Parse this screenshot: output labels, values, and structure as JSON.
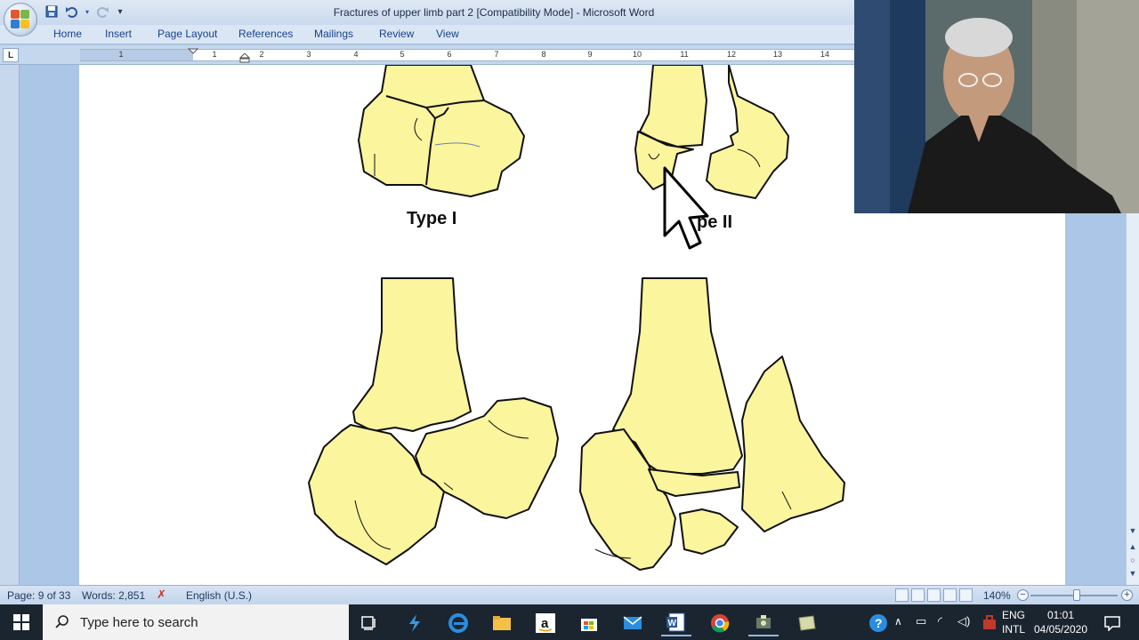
{
  "window": {
    "title": "Fractures of upper limb part 2 [Compatibility Mode] - Microsoft Word"
  },
  "ribbon": {
    "tabs": [
      "Home",
      "Insert",
      "Page Layout",
      "References",
      "Mailings",
      "Review",
      "View"
    ]
  },
  "ruler": {
    "numbers": [
      "1",
      "1",
      "2",
      "3",
      "4",
      "5",
      "6",
      "7",
      "8",
      "9",
      "10",
      "11",
      "12",
      "13",
      "14"
    ]
  },
  "document": {
    "figure_labels": {
      "type1": "Type I",
      "type2": "pe II"
    }
  },
  "statusbar": {
    "page": "Page: 9 of 33",
    "words": "Words: 2,851",
    "language": "English (U.S.)",
    "zoom": "140%",
    "zoom_level": 1.4
  },
  "taskbar": {
    "search_placeholder": "Type here to search",
    "lang_top": "ENG",
    "lang_bottom": "INTL",
    "time": "01:01",
    "date": "04/05/2020"
  },
  "colors": {
    "bone_fill": "#fbf59e",
    "ribbon_bg": "#dbe6f4",
    "workspace_bg": "#abc6e6",
    "taskbar_bg": "#1b2530"
  }
}
